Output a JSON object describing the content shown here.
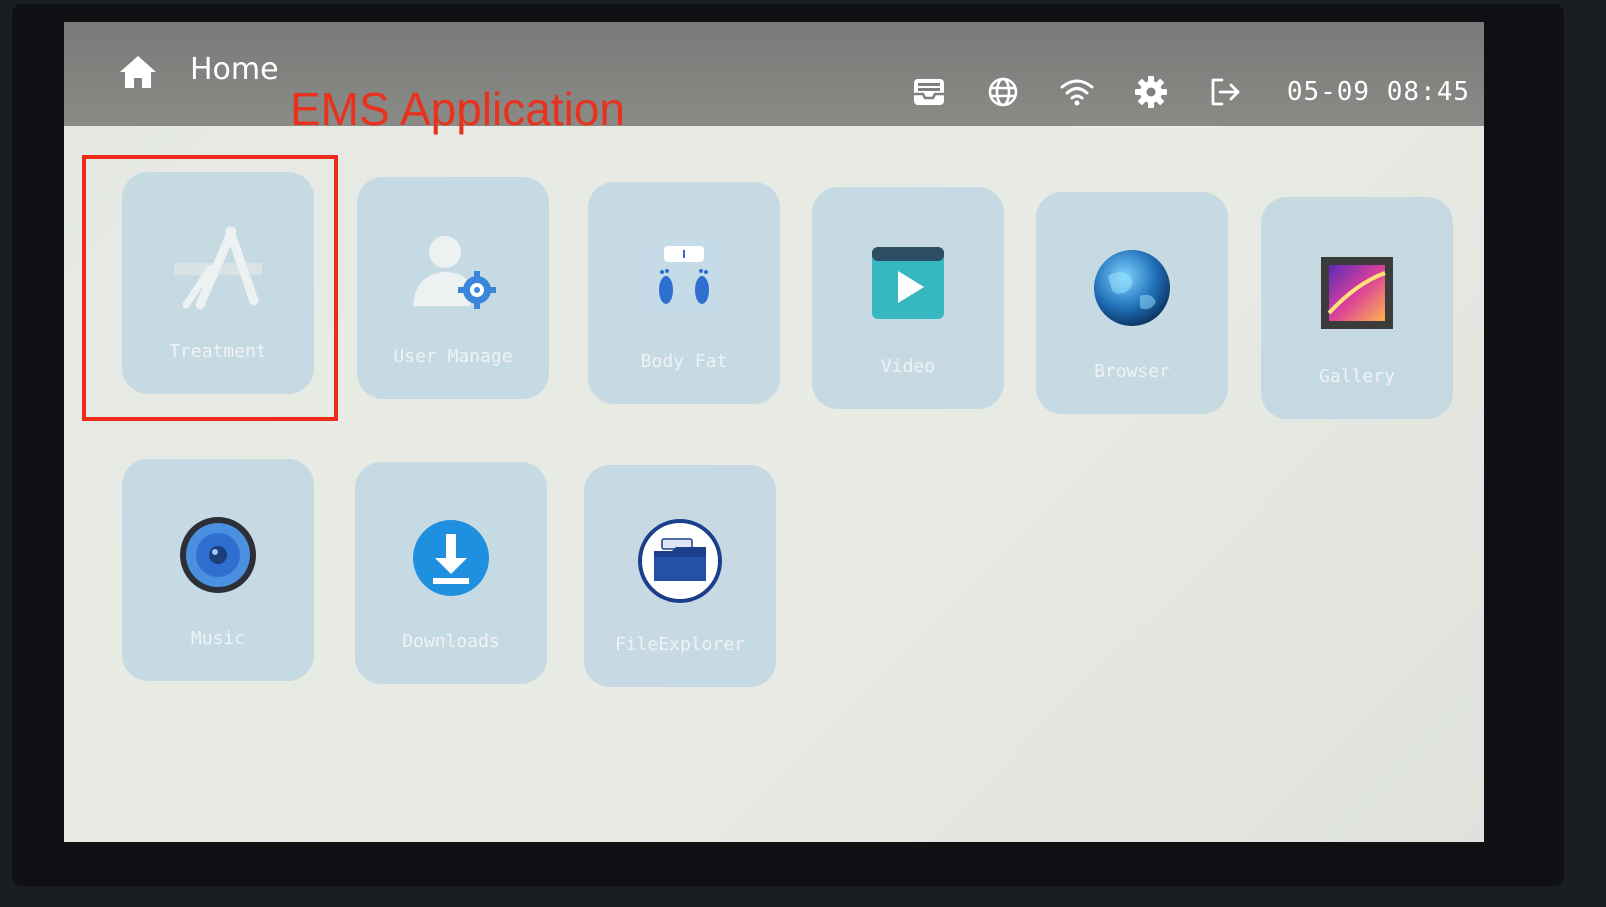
{
  "topbar": {
    "title": "Home",
    "clock": "05-09 08:45",
    "status_icons": [
      "inbox-icon",
      "globe-icon",
      "wifi-icon",
      "gear-icon",
      "logout-icon"
    ]
  },
  "annotation": {
    "label": "EMS Application",
    "color": "#e8321e"
  },
  "apps": [
    {
      "label": "Treatment",
      "icon": "app-store-icon"
    },
    {
      "label": "User Manage",
      "icon": "user-gear-icon"
    },
    {
      "label": "Body Fat",
      "icon": "scale-icon"
    },
    {
      "label": "Video",
      "icon": "play-icon"
    },
    {
      "label": "Browser",
      "icon": "globe-icon"
    },
    {
      "label": "Gallery",
      "icon": "picture-icon"
    },
    {
      "label": "Music",
      "icon": "speaker-icon"
    },
    {
      "label": "Downloads",
      "icon": "download-icon"
    },
    {
      "label": "FileExplorer",
      "icon": "folder-icon"
    }
  ],
  "colors": {
    "tile": "#b2d0e2",
    "accent_blue": "#2f6fd0",
    "topbar": "#7f7f7d"
  }
}
